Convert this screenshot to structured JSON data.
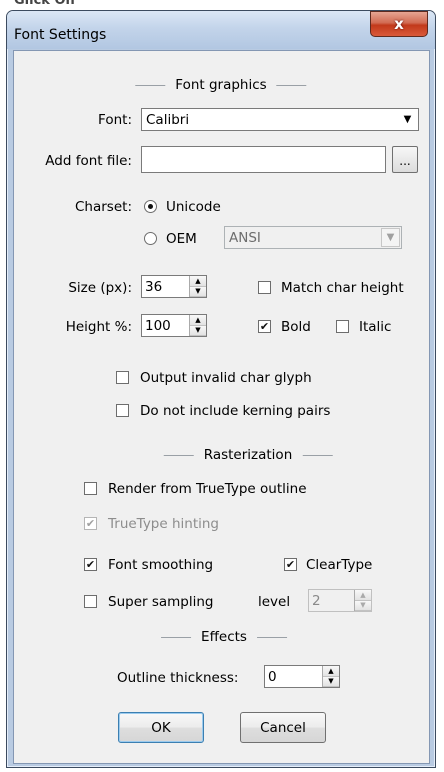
{
  "window": {
    "title": "Font Settings",
    "close_glyph": "x",
    "clipped_top_text": "Glick On"
  },
  "font_graphics": {
    "heading": "Font graphics",
    "font_label": "Font:",
    "font_value": "Calibri",
    "add_font_label": "Add font file:",
    "add_font_value": "",
    "browse_label": "...",
    "charset_label": "Charset:",
    "charset_unicode": "Unicode",
    "charset_oem": "OEM",
    "charset_selected": "Unicode",
    "oem_value": "ANSI",
    "size_label": "Size (px):",
    "size_value": "36",
    "height_label": "Height %:",
    "height_value": "100",
    "match_char_height": "Match char height",
    "match_char_height_checked": false,
    "bold": "Bold",
    "bold_checked": true,
    "italic": "Italic",
    "italic_checked": false,
    "output_invalid": "Output invalid char glyph",
    "output_invalid_checked": false,
    "no_kerning": "Do not include kerning pairs",
    "no_kerning_checked": false
  },
  "rasterization": {
    "heading": "Rasterization",
    "render_truetype": "Render from TrueType outline",
    "render_truetype_checked": false,
    "truetype_hinting": "TrueType hinting",
    "truetype_hinting_checked": true,
    "font_smoothing": "Font smoothing",
    "font_smoothing_checked": true,
    "cleartype": "ClearType",
    "cleartype_checked": true,
    "super_sampling": "Super sampling",
    "super_sampling_checked": false,
    "level_label": "level",
    "level_value": "2"
  },
  "effects": {
    "heading": "Effects",
    "outline_label": "Outline thickness:",
    "outline_value": "0"
  },
  "buttons": {
    "ok": "OK",
    "cancel": "Cancel"
  },
  "glyphs": {
    "check": "✔",
    "arrow_down": "▼",
    "arrow_up_small": "▲",
    "arrow_down_small": "▼"
  }
}
